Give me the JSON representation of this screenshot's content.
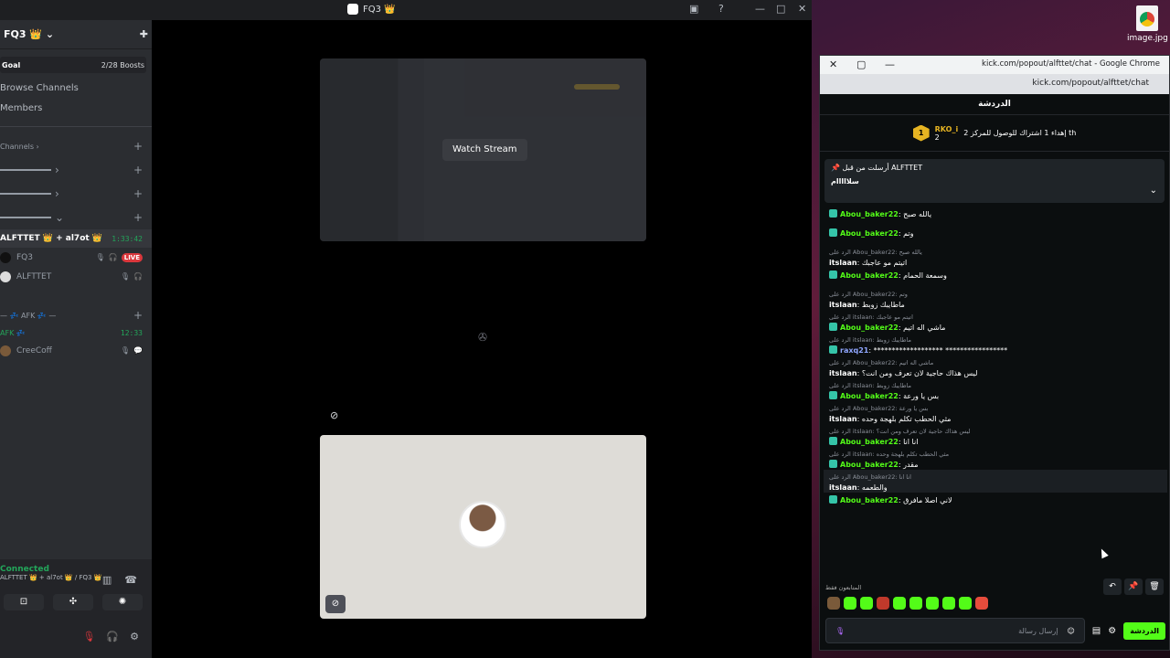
{
  "desktop": {
    "icon_label": "image.jpg"
  },
  "discord": {
    "window_title": "FQ3 👑",
    "server_name": "FQ3 👑",
    "goal": {
      "label": "Goal",
      "boosts": "2/28 Boosts"
    },
    "nav": [
      "Browse Channels",
      "Members"
    ],
    "category": "Channels",
    "voice_channel": {
      "name": "ALFTTET 👑 + al7ot 👑",
      "time": "1:33:42"
    },
    "users": [
      {
        "name": "FQ3",
        "live": "LIVE"
      },
      {
        "name": "ALFTTET"
      }
    ],
    "afk_category": "— 💤 AFK 💤 —",
    "afk_channel": {
      "name": "AFK 💤",
      "time": "12:33"
    },
    "afk_user": "CreeCoff",
    "connection": {
      "status": "Connected",
      "sub": "ALFTTET 👑 + al7ot 👑 / FQ3 👑"
    },
    "watch_button": "Watch Stream"
  },
  "chrome": {
    "title": "kick.com/popout/alfttet/chat - Google Chrome",
    "url": "kick.com/popout/alfttet/chat",
    "chat_header": "الدردشة",
    "goal_user": "RKO_i",
    "goal_rank": "1",
    "goal_count": "2",
    "goal_text": "إهداء 1 اشتراك للوصول للمركز 2 th",
    "pinned": {
      "by_label": "أرسلت من قبل",
      "author": "ALFTTET",
      "text": "سلااااام"
    },
    "messages": [
      {
        "user": "Abou_baker22",
        "text": "يالله صبح",
        "color": "green"
      },
      {
        "user": "Abou_baker22",
        "text": "وتم",
        "color": "green"
      },
      {
        "reply": "الرد على Abou_baker22: يالله صبح",
        "user": "itslaan",
        "text": "اتيتم مو عاجبك",
        "color": "white"
      },
      {
        "user": "Abou_baker22",
        "text": "وسمعة الحمام",
        "color": "green"
      },
      {
        "reply": "الرد على Abou_baker22: وتم",
        "user": "itslaan",
        "text": "ماطايبك زوبط",
        "color": "white"
      },
      {
        "reply": "الرد على itslaan: اتيتم مو عاجبك",
        "user": "Abou_baker22",
        "text": "ماشي اله اتيم",
        "color": "green"
      },
      {
        "reply": "الرد على itslaan: ماطايبك زوبط",
        "user": "raxq21",
        "text": "*******************  *****************",
        "color": "blue"
      },
      {
        "reply": "الرد على Abou_baker22: ماشي اله اتيم",
        "user": "itslaan",
        "text": "ليس هذاك حاجية لان تعرف ومن انت؟",
        "color": "white"
      },
      {
        "reply": "الرد على itslaan: ماطايبك زوبط",
        "user": "Abou_baker22",
        "text": "بس يا ورعة",
        "color": "green"
      },
      {
        "reply": "الرد على Abou_baker22: بس يا ورعة",
        "user": "itslaan",
        "text": "مثي الحطب تكلم بلهجة وحده",
        "color": "white"
      },
      {
        "reply": "الرد على itslaan: ليس هذاك حاجية لان تعرف ومن انت؟",
        "user": "Abou_baker22",
        "text": "انا انا",
        "color": "green"
      },
      {
        "reply": "الرد على itslaan: مثي الحطب تكلم بلهجة وحده",
        "user": "Abou_baker22",
        "text": "مقدر",
        "color": "green"
      },
      {
        "reply": "الرد على Abou_baker22: انا انا",
        "user": "itslaan",
        "text": "والطعمه",
        "color": "white",
        "highlight": true
      },
      {
        "user": "Abou_baker22",
        "text": "لاني اصلا مافرق",
        "color": "green"
      }
    ],
    "emote_label": "المتابعون فقط",
    "input_placeholder": "إرسال رسالة",
    "chat_button": "الدردشة"
  }
}
